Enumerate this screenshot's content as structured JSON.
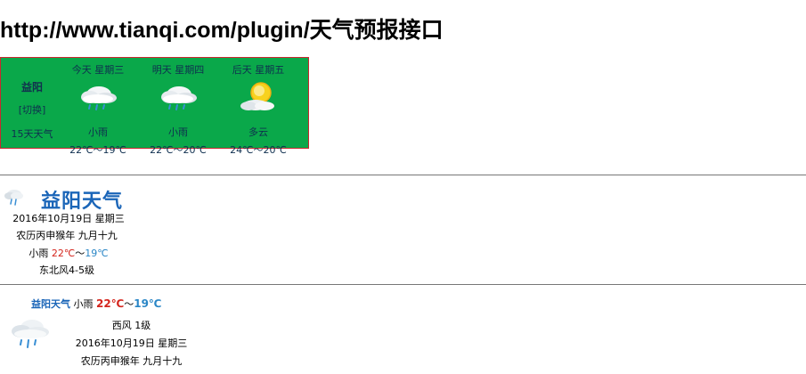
{
  "page": {
    "title": "http://www.tianqi.com/plugin/天气预报接口"
  },
  "widget1": {
    "city": "益阳",
    "switch_label": "[切换]",
    "fifteen_day_label": "15天天气",
    "days": [
      {
        "label": "今天  星期三",
        "icon": "rain-cloud-icon",
        "condition": "小雨",
        "temp": "22℃～19℃"
      },
      {
        "label": "明天  星期四",
        "icon": "rain-cloud-icon",
        "condition": "小雨",
        "temp": "22℃～20℃"
      },
      {
        "label": "后天  星期五",
        "icon": "partly-cloudy-icon",
        "condition": "多云",
        "temp": "24℃～20℃"
      }
    ],
    "colors": {
      "background": "#0aa84a",
      "border": "#c8282e"
    }
  },
  "widget2": {
    "title": "益阳天气",
    "date": "2016年10月19日 星期三",
    "lunar": "农历丙申猴年 九月十九",
    "condition": "小雨",
    "temp_high": "22℃",
    "temp_sep": "～",
    "temp_low": "19℃",
    "wind": "东北风4-5级",
    "icon": "rain-cloud-icon"
  },
  "widget3": {
    "city": "益阳天气",
    "condition": "小雨",
    "temp_high": "22℃",
    "temp_sep": "～",
    "temp_low": "19℃",
    "wind": "西风 1级",
    "date": "2016年10月19日 星期三",
    "lunar": "农历丙申猴年 九月十九",
    "icon": "rain-cloud-icon"
  }
}
